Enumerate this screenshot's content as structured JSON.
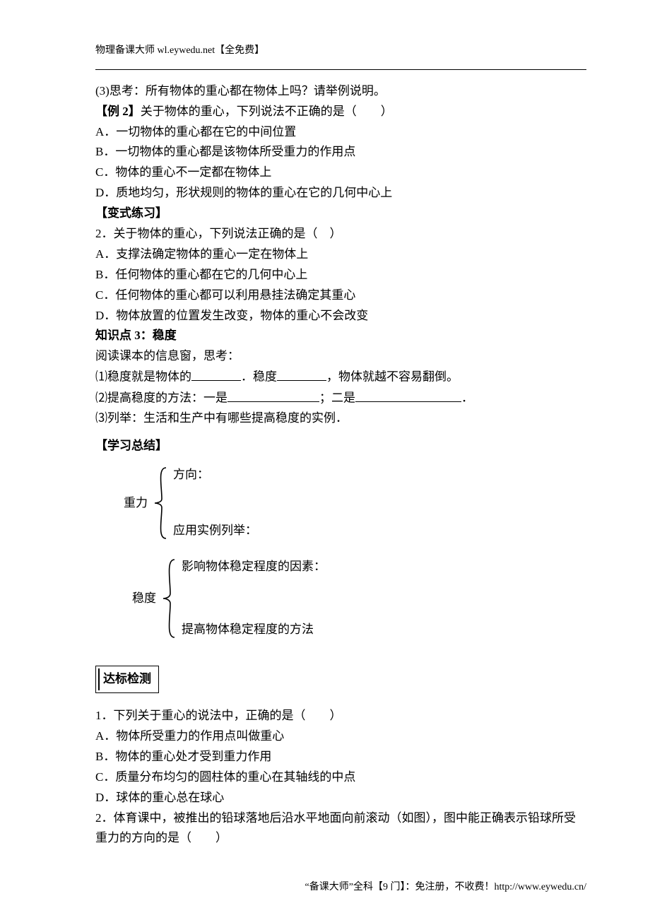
{
  "header": {
    "site": "物理备课大师 wl.eywedu.net【全免费】"
  },
  "body": {
    "l1": "(3)思考：所有物体的重心都在物体上吗？请举例说明。",
    "ex2": {
      "label": "【例 2】",
      "text": "关于物体的重心，下列说法不正确的是（　　）"
    },
    "ex2_a": "A．一切物体的重心都在它的中间位置",
    "ex2_b": "B．一切物体的重心都是该物体所受重力的作用点",
    "ex2_c": "C．物体的重心不一定都在物体上",
    "ex2_d": "D．质地均匀，形状规则的物体的重心在它的几何中心上",
    "var_label": "【变式练习】",
    "var_q": "2．关于物体的重心，下列说法正确的是（　）",
    "var_a": "A．支撑法确定物体的重心一定在物体上",
    "var_b": "B．任何物体的重心都在它的几何中心上",
    "var_c": "C．任何物体的重心都可以利用悬挂法确定其重心",
    "var_d": "D．物体放置的位置发生改变，物体的重心不会改变",
    "kp3_title": "知识点 3：稳度",
    "kp3_l1": "阅读课本的信息窗，思考：",
    "kp3_a_pre": "⑴稳度就是物体的",
    "kp3_a_mid": "．稳度",
    "kp3_a_post": "，物体就越不容易翻倒。",
    "kp3_b_pre": "⑵提高稳度的方法：一是",
    "kp3_b_mid": "；二是",
    "kp3_b_post": "．",
    "kp3_c": "⑶列举：生活和生产中有哪些提高稳度的实例．",
    "summary_title": "【学习总结】",
    "brace1_label": "重力",
    "brace1_i1": "方向：",
    "brace1_i2": "应用实例列举：",
    "brace2_label": "稳度",
    "brace2_i1": "影响物体稳定程度的因素：",
    "brace2_i2": "提高物体稳定程度的方法",
    "check_title": "达标检测",
    "q1": "1．下列关于重心的说法中，正确的是（　　）",
    "q1_a": "A．物体所受重力的作用点叫做重心",
    "q1_b": "B．物体的重心处才受到重力作用",
    "q1_c": "C．质量分布均匀的圆柱体的重心在其轴线的中点",
    "q1_d": "D．球体的重心总在球心",
    "q2": "2．体育课中，被推出的铅球落地后沿水平地面向前滚动（如图），图中能正确表示铅球所受重力的方向的是（　　）"
  },
  "footer": {
    "text": "“备课大师”全科【9 门】：免注册，不收费！http://www.eywedu.cn/"
  }
}
